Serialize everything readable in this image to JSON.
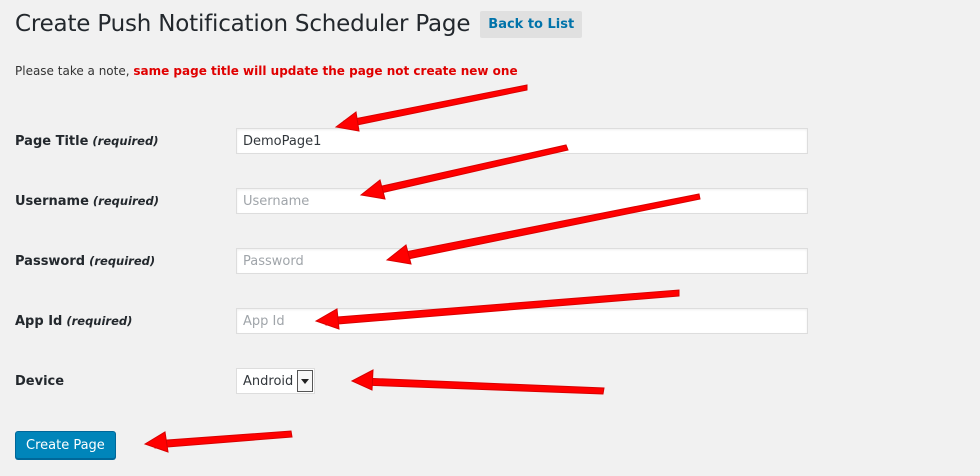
{
  "header": {
    "title": "Create Push Notification Scheduler Page",
    "back_label": "Back to List"
  },
  "notice": {
    "prefix": "Please take a note, ",
    "warning": "same page title will update the page not create new one"
  },
  "form": {
    "required_tag": "(required)",
    "page_title": {
      "label": "Page Title",
      "value": "DemoPage1",
      "placeholder": ""
    },
    "username": {
      "label": "Username",
      "value": "",
      "placeholder": "Username"
    },
    "password": {
      "label": "Password",
      "value": "",
      "placeholder": "Password"
    },
    "app_id": {
      "label": "App Id",
      "value": "",
      "placeholder": "App Id"
    },
    "device": {
      "label": "Device",
      "selected": "Android"
    },
    "submit_label": "Create Page"
  },
  "colors": {
    "background": "#f1f1f1",
    "link": "#0073aa",
    "warning": "#e00000",
    "primary_button": "#0085ba",
    "annotation_arrow": "#ff0000"
  }
}
